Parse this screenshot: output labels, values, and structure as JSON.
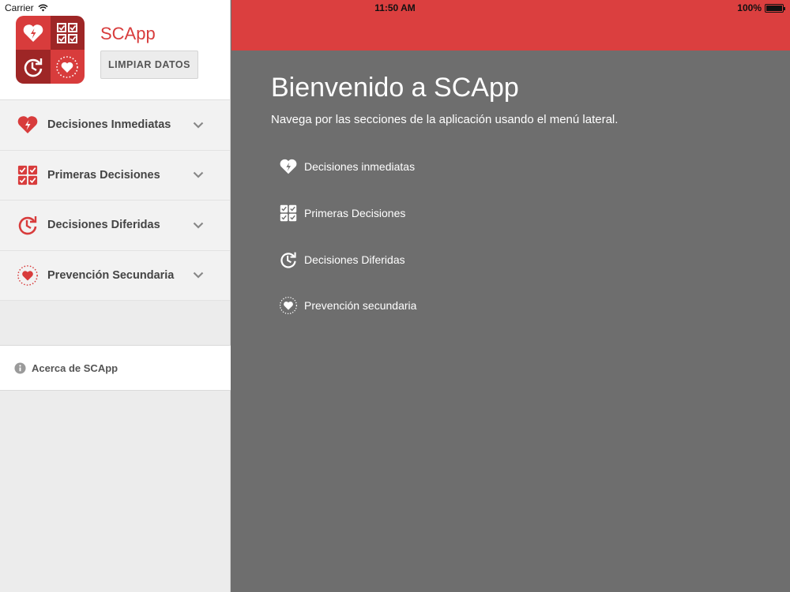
{
  "status_bar": {
    "carrier": "Carrier",
    "time": "11:50 AM",
    "battery": "100%"
  },
  "sidebar": {
    "app_name": "SCApp",
    "clear_button": "LIMPIAR DATOS",
    "menu": [
      {
        "label": "Decisiones Inmediatas",
        "icon": "heart-bolt-icon"
      },
      {
        "label": "Primeras Decisiones",
        "icon": "checklist-icon"
      },
      {
        "label": "Decisiones Diferidas",
        "icon": "clock-arrow-icon"
      },
      {
        "label": "Prevención Secundaria",
        "icon": "heart-circle-icon"
      }
    ],
    "about": "Acerca de SCApp"
  },
  "main": {
    "title": "Bienvenido a SCApp",
    "subtitle": "Navega por las secciones de la aplicación usando el menú lateral.",
    "sections": [
      {
        "label": "Decisiones inmediatas",
        "icon": "heart-bolt-icon"
      },
      {
        "label": "Primeras Decisiones",
        "icon": "checklist-icon"
      },
      {
        "label": "Decisiones Diferidas",
        "icon": "clock-arrow-icon"
      },
      {
        "label": "Prevención secundaria",
        "icon": "heart-circle-icon"
      }
    ]
  },
  "colors": {
    "brand_red": "#db3f3f",
    "dark_red": "#9e2626",
    "main_bg": "#6e6e6e",
    "sidebar_bg": "#ececec"
  }
}
